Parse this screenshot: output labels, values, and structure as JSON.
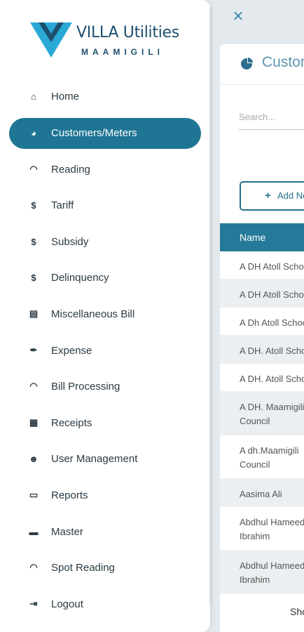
{
  "background": {
    "close_label": "×",
    "title": "Customers/Meters",
    "search_placeholder": "Search...",
    "add_button_label": "Add New",
    "table": {
      "header_name": "Name",
      "rows": [
        [
          "A DH Atoll School"
        ],
        [
          "A DH Atoll School"
        ],
        [
          "A Dh Atoll School"
        ],
        [
          "A DH. Atoll School"
        ],
        [
          "A DH. Atoll School"
        ],
        [
          "A DH. Maamigili",
          "Council"
        ],
        [
          "A dh.Maamigili",
          "Council"
        ],
        [
          "Aasima Ali"
        ],
        [
          "Abdhul Hameed",
          "Ibrahim"
        ],
        [
          "Abdhul Hameed",
          "Ibrahim"
        ]
      ]
    },
    "pager_text": "Showing"
  },
  "drawer": {
    "logo": {
      "title": "VILLA Utilities",
      "subtitle": "MAAMIGILI"
    },
    "items": [
      {
        "label": "Home",
        "icon": "home-icon",
        "glyph": "⌂"
      },
      {
        "label": "Customers/Meters",
        "icon": "pie-chart-icon",
        "glyph": "◕"
      },
      {
        "label": "Reading",
        "icon": "gauge-icon",
        "glyph": "◠"
      },
      {
        "label": "Tariff",
        "icon": "dollar-icon",
        "glyph": "$"
      },
      {
        "label": "Subsidy",
        "icon": "dollar-icon",
        "glyph": "$"
      },
      {
        "label": "Delinquency",
        "icon": "dollar-icon",
        "glyph": "$"
      },
      {
        "label": "Miscellaneous Bill",
        "icon": "bill-icon",
        "glyph": "▤"
      },
      {
        "label": "Expense",
        "icon": "feather-icon",
        "glyph": "✒"
      },
      {
        "label": "Bill Processing",
        "icon": "gauge-icon",
        "glyph": "◠"
      },
      {
        "label": "Receipts",
        "icon": "receipt-icon",
        "glyph": "▦"
      },
      {
        "label": "User Management",
        "icon": "users-icon",
        "glyph": "☻"
      },
      {
        "label": "Reports",
        "icon": "report-icon",
        "glyph": "▭"
      },
      {
        "label": "Master",
        "icon": "printer-icon",
        "glyph": "▬"
      },
      {
        "label": "Spot Reading",
        "icon": "gauge-icon",
        "glyph": "◠"
      },
      {
        "label": "Logout",
        "icon": "logout-icon",
        "glyph": "⇥"
      }
    ],
    "active_index": 1
  },
  "colors": {
    "accent": "#1f7594",
    "header": "#247a98",
    "text": "#2b3a44",
    "logo": "#1d4f6e"
  }
}
